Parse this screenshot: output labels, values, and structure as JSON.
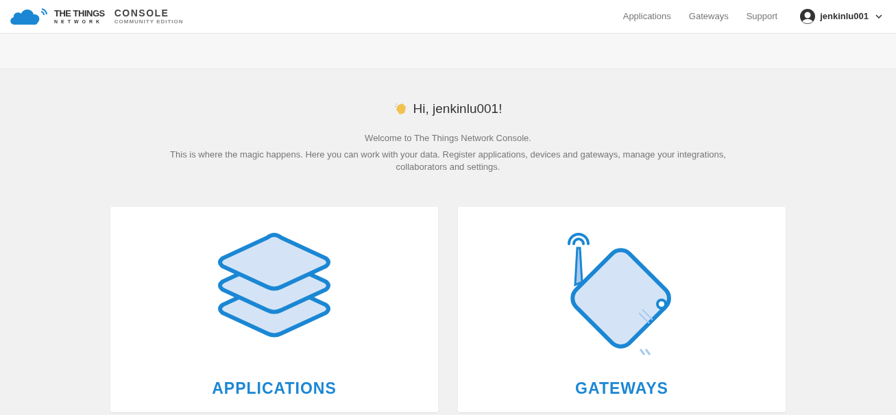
{
  "header": {
    "logo": {
      "line_1": "THE THINGS",
      "line_2": "NETWORK",
      "product": "CONSOLE",
      "edition": "COMMUNITY EDITION"
    },
    "nav": [
      "Applications",
      "Gateways",
      "Support"
    ],
    "user": {
      "name": "jenkinlu001"
    }
  },
  "greeting": {
    "title": "Hi, jenkinlu001!",
    "welcome": "Welcome to The Things Network Console.",
    "description": "This is where the magic happens. Here you can work with your data. Register applications, devices and gateways, manage your integrations, collaborators and settings."
  },
  "cards": [
    {
      "kind": "applications",
      "label": "APPLICATIONS"
    },
    {
      "kind": "gateways",
      "label": "GATEWAYS"
    }
  ]
}
